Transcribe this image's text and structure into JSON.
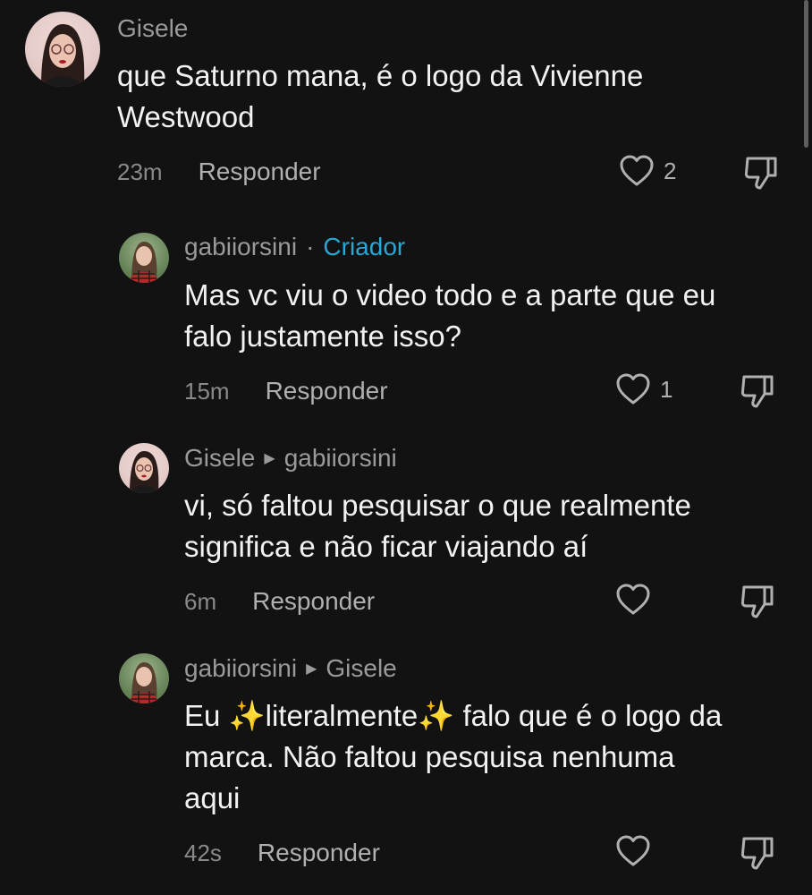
{
  "comments": [
    {
      "user": "Gisele",
      "text": "que Saturno mana, é o logo da Vivienne\nWestwood",
      "time": "23m",
      "reply": "Responder",
      "likes": "2"
    },
    {
      "user": "gabiiorsini",
      "separator": "·",
      "badge": "Criador",
      "text": "Mas vc viu o video todo e a parte que eu\nfalo justamente isso?",
      "time": "15m",
      "reply": "Responder",
      "likes": "1"
    },
    {
      "user": "Gisele",
      "reply_to": "gabiiorsini",
      "text": "vi, só faltou pesquisar o que realmente\nsignifica e não ficar viajando aí",
      "time": "6m",
      "reply": "Responder",
      "likes": ""
    },
    {
      "user": "gabiiorsini",
      "reply_to": "Gisele",
      "text": "Eu ✨literalmente✨  falo que é o logo da\nmarca. Não faltou pesquisa nenhuma\naqui",
      "time": "42s",
      "reply": "Responder",
      "likes": ""
    }
  ],
  "icons": {
    "like": "heart-outline-icon",
    "dislike": "thumbs-down-outline-icon",
    "reply_arrow": "triangle-right-icon"
  },
  "colors": {
    "background": "#121212",
    "creator_badge": "#27a7d4"
  }
}
